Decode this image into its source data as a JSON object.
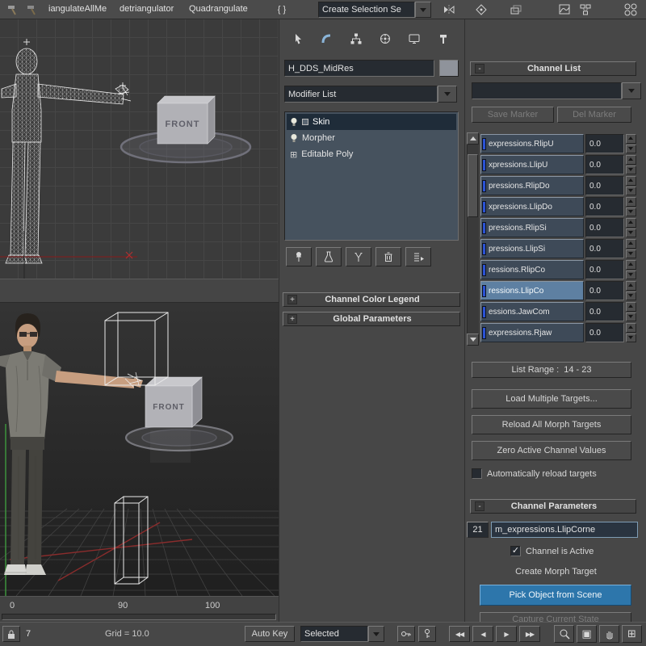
{
  "toolbar": {
    "script_buttons": [
      "iangulateAllMe",
      "detriangulator",
      "Quadrangulate"
    ],
    "braces_label": "{ }",
    "selection_set_label": "Create Selection Se"
  },
  "command_panel": {
    "object_name": "H_DDS_MidRes",
    "modifier_list_label": "Modifier List",
    "stack": [
      {
        "label": "Skin",
        "selected": true
      },
      {
        "label": "Morpher",
        "selected": false
      },
      {
        "label": "Editable Poly",
        "selected": false
      }
    ],
    "editable_poly_prefix": "⊞",
    "rollouts": [
      {
        "state": "+",
        "title": "Channel Color Legend"
      },
      {
        "state": "+",
        "title": "Global Parameters"
      }
    ]
  },
  "channel_list": {
    "state": "-",
    "title": "Channel List",
    "marker_dropdown_value": "",
    "save_marker_label": "Save Marker",
    "del_marker_label": "Del Marker",
    "channels": [
      {
        "name": "expressions.RlipU",
        "value": "0.0",
        "selected": false
      },
      {
        "name": "xpressions.LlipU",
        "value": "0.0",
        "selected": false
      },
      {
        "name": "pressions.RlipDo",
        "value": "0.0",
        "selected": false
      },
      {
        "name": "xpressions.LlipDo",
        "value": "0.0",
        "selected": false
      },
      {
        "name": "pressions.RlipSi",
        "value": "0.0",
        "selected": false
      },
      {
        "name": "pressions.LlipSi",
        "value": "0.0",
        "selected": false
      },
      {
        "name": "ressions.RlipCo",
        "value": "0.0",
        "selected": false
      },
      {
        "name": "ressions.LlipCo",
        "value": "0.0",
        "selected": true
      },
      {
        "name": "essions.JawCom",
        "value": "0.0",
        "selected": false
      },
      {
        "name": "expressions.Rjaw",
        "value": "0.0",
        "selected": false
      }
    ],
    "list_range_label": "List Range :",
    "list_range_value": "14 - 23",
    "load_multiple_label": "Load Multiple Targets...",
    "reload_all_label": "Reload All Morph Targets",
    "zero_active_label": "Zero Active Channel Values",
    "auto_reload_label": "Automatically reload targets"
  },
  "channel_parameters": {
    "state": "-",
    "title": "Channel Parameters",
    "channel_number": "21",
    "channel_name": "m_expressions.LlipCorne",
    "channel_active_label": "Channel is Active",
    "create_morph_label": "Create Morph Target",
    "pick_object_label": "Pick Object from Scene",
    "capture_state_label": "Capture Current State"
  },
  "viewports": {
    "front_label": "FRONT",
    "track_numbers": [
      "0",
      "90",
      "100"
    ]
  },
  "status_bar": {
    "left_value": "7",
    "grid_label": "Grid = 10.0",
    "auto_key_label": "Auto Key",
    "selected_label": "Selected"
  },
  "icons": {
    "rewind": "◀◀",
    "prev_frame": "◀",
    "play": "▶",
    "next_frame": "▶▶",
    "zoom_extents": "▣",
    "maximize": "⊞"
  },
  "colors": {
    "accent_blue": "#2d76ab",
    "channel_button": "#3e4a58",
    "channel_selected": "#5e80a2"
  }
}
